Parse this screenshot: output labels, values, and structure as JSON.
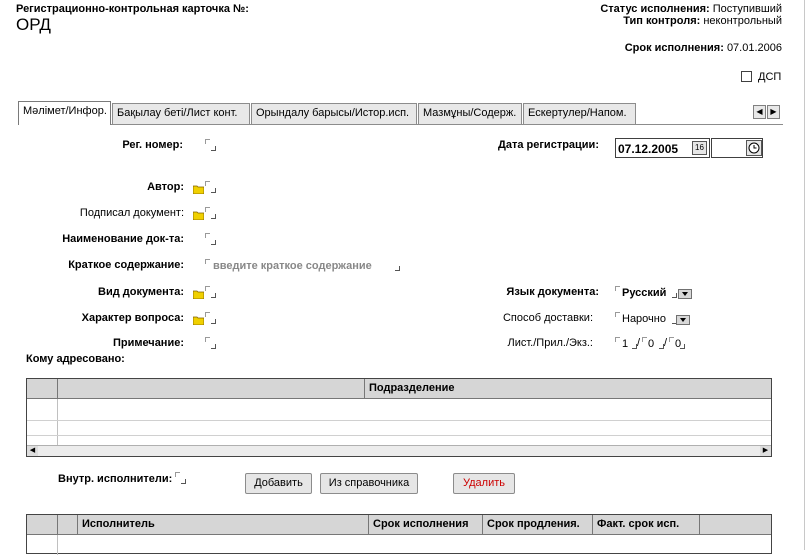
{
  "header": {
    "title": "Регистрационно-контрольная карточка №:",
    "code": "ОРД",
    "status_label": "Статус исполнения:",
    "status_value": "Поступивший",
    "control_label": "Тип контроля:",
    "control_value": "неконтрольный",
    "deadline_label": "Срок исполнения:",
    "deadline_value": "07.01.2006",
    "dsp_label": "ДСП"
  },
  "tabs": [
    {
      "label": "Мәлімет/Инфор."
    },
    {
      "label": "Бақылау беті/Лист конт."
    },
    {
      "label": "Орындалу барысы/Истор.исп."
    },
    {
      "label": "Мазмұны/Содерж."
    },
    {
      "label": "Ескертулер/Напом."
    }
  ],
  "form": {
    "reg_number_label": "Рег. номер:",
    "reg_date_label": "Дата регистрации:",
    "reg_date_value": "07.12.2005",
    "calendar_label": "16",
    "author_label": "Автор:",
    "signed_label": "Подписал документ:",
    "doc_name_label": "Наименование док-та:",
    "summary_label": "Краткое содержание:",
    "summary_placeholder": "введите краткое содержание",
    "doc_type_label": "Вид документа:",
    "language_label": "Язык документа:",
    "language_value": "Русский",
    "question_label": "Характер вопроса:",
    "delivery_label": "Способ доставки:",
    "delivery_value": "Нарочно",
    "note_label": "Примечание:",
    "sheets_label": "Лист./Прил./Экз.:",
    "sheets_value": "1",
    "attach_value": "0",
    "copies_value": "0",
    "addressed_label": "Кому адресовано:"
  },
  "address_grid": {
    "columns": [
      "Подразделение"
    ]
  },
  "executors": {
    "label": "Внутр. исполнители:",
    "add_button": "Добавить",
    "from_ref_button": "Из справочника",
    "delete_button": "Удалить",
    "delete_color": "#cc0000",
    "columns": [
      "Исполнитель",
      "Срок исполнения",
      "Срок продления.",
      "Факт. срок исп."
    ]
  }
}
